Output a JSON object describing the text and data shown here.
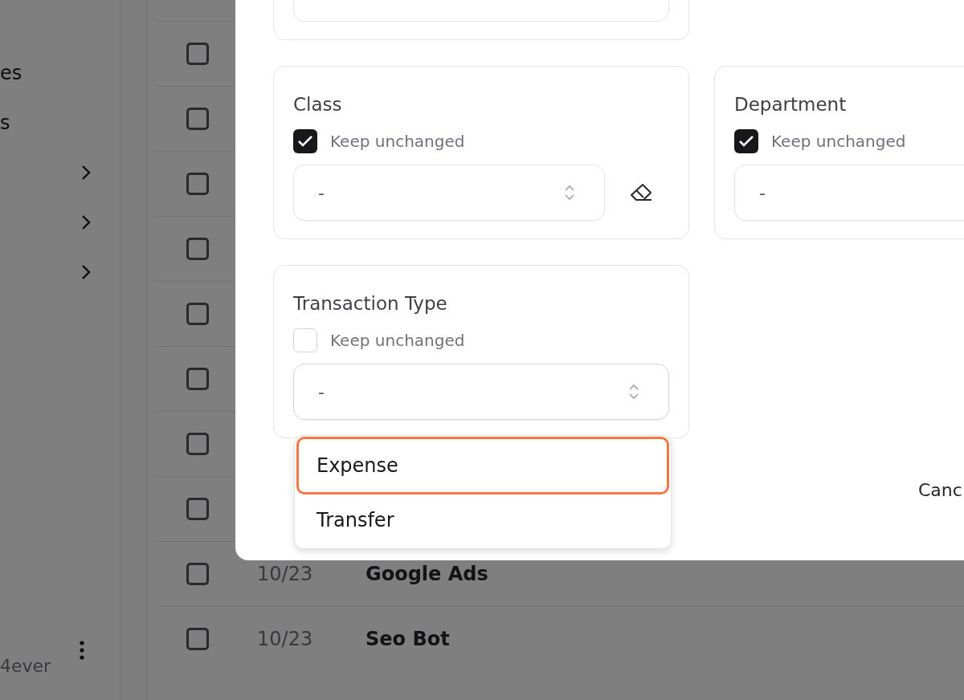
{
  "sidebar": {
    "items": [
      {
        "kind": "link",
        "label": "es"
      },
      {
        "kind": "link",
        "label": "s"
      },
      {
        "kind": "group",
        "expanded": false
      },
      {
        "kind": "group",
        "expanded": false
      },
      {
        "kind": "group",
        "expanded": false
      }
    ],
    "user": {
      "name": "4ever"
    }
  },
  "table": {
    "rows": [
      {
        "checked": false
      },
      {
        "checked": false
      },
      {
        "checked": false
      },
      {
        "checked": false
      },
      {
        "checked": false
      },
      {
        "checked": false
      },
      {
        "checked": false
      },
      {
        "checked": false
      },
      {
        "checked": false,
        "date": "10/23",
        "name": "Google Ads"
      },
      {
        "checked": false,
        "date": "10/23",
        "name": "Seo Bot"
      }
    ]
  },
  "dialog": {
    "fields": [
      {
        "kind": "blank"
      },
      {
        "kind": "select",
        "label": "Class",
        "keep_unchanged": true,
        "keep_label": "Keep unchanged",
        "value": "-",
        "clearable": true
      },
      {
        "kind": "select",
        "label": "Department",
        "keep_unchanged": true,
        "keep_label": "Keep unchanged",
        "value": "-",
        "clearable": false
      },
      {
        "kind": "select",
        "label": "Transaction Type",
        "keep_unchanged": false,
        "keep_label": "Keep unchanged",
        "value": "-",
        "clearable": false,
        "open": true,
        "options": [
          {
            "label": "Expense",
            "selected": true
          },
          {
            "label": "Transfer",
            "selected": false
          }
        ]
      }
    ],
    "cancel_button": "Canc"
  }
}
